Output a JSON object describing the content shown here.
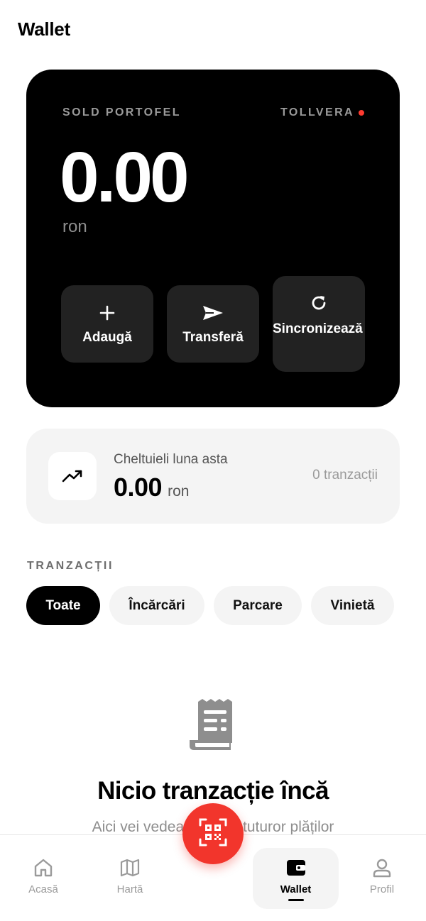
{
  "header": {
    "title": "Wallet"
  },
  "wallet_card": {
    "label": "SOLD PORTOFEL",
    "brand": "TOLLVERA",
    "balance": "0.00",
    "currency": "ron",
    "actions": [
      {
        "label": "Adaugă",
        "icon": "plus-icon"
      },
      {
        "label": "Transferă",
        "icon": "send-icon"
      },
      {
        "label": "Sincronizează",
        "icon": "refresh-icon"
      }
    ]
  },
  "spending": {
    "label": "Cheltuieli luna asta",
    "value": "0.00",
    "currency": "ron",
    "count": "0 tranzacții",
    "icon": "trending-up-icon"
  },
  "transactions": {
    "title": "TRANZACȚII",
    "filters": [
      "Toate",
      "Încărcări",
      "Parcare",
      "Vinietă"
    ],
    "active_filter": "Toate",
    "empty": {
      "icon": "receipt-icon",
      "title": "Nicio tranzacție încă",
      "subtitle": "Aici vei vedea istoricul tuturor plăților"
    }
  },
  "bottom_nav": {
    "items": [
      {
        "label": "Acasă",
        "icon": "home-icon"
      },
      {
        "label": "Hartă",
        "icon": "map-icon"
      },
      {
        "label": "Wallet",
        "icon": "wallet-icon"
      },
      {
        "label": "Profil",
        "icon": "profile-icon"
      }
    ],
    "active": "Wallet",
    "fab_icon": "qr-scan-icon"
  },
  "colors": {
    "accent": "#f2352c",
    "card_dark": "#000000",
    "surface": "#f4f4f4",
    "muted_text": "#9a9a9a"
  }
}
